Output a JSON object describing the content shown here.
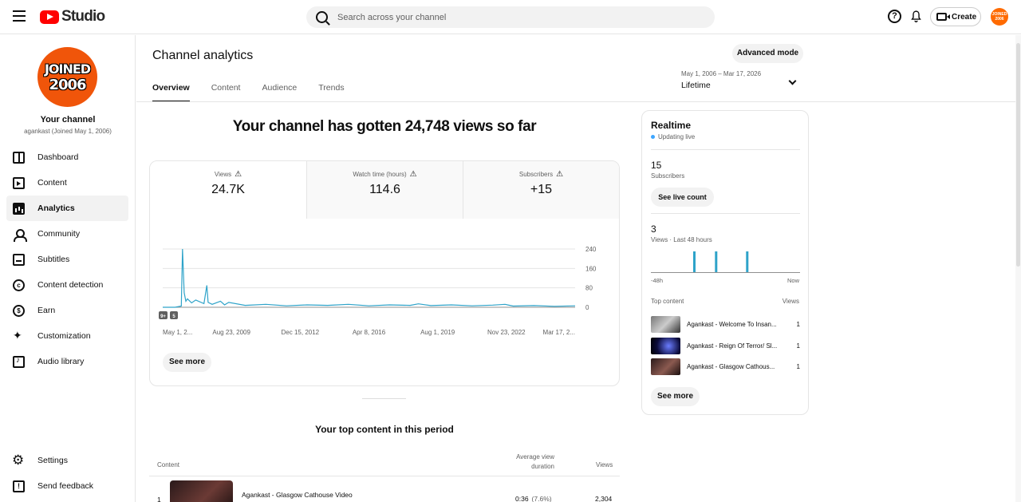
{
  "header": {
    "app_name": "Studio",
    "search_placeholder": "Search across your channel",
    "help_glyph": "?",
    "create_label": "Create",
    "avatar_text": "JOINED 2006"
  },
  "sidebar": {
    "avatar_line1": "JOINED",
    "avatar_line2": "2006",
    "channel_title": "Your channel",
    "channel_subtitle": "agankast (Joined May 1, 2006)",
    "items": [
      {
        "label": "Dashboard",
        "icon": "dashboard-icon"
      },
      {
        "label": "Content",
        "icon": "content-icon"
      },
      {
        "label": "Analytics",
        "icon": "analytics-icon",
        "active": true
      },
      {
        "label": "Community",
        "icon": "community-icon"
      },
      {
        "label": "Subtitles",
        "icon": "subtitles-icon"
      },
      {
        "label": "Content detection",
        "icon": "copyright-icon"
      },
      {
        "label": "Earn",
        "icon": "dollar-icon"
      },
      {
        "label": "Customization",
        "icon": "magic-wand-icon"
      },
      {
        "label": "Audio library",
        "icon": "audio-library-icon"
      }
    ],
    "bottom_items": [
      {
        "label": "Settings",
        "icon": "gear-icon"
      },
      {
        "label": "Send feedback",
        "icon": "feedback-icon"
      }
    ]
  },
  "main": {
    "title": "Channel analytics",
    "advanced_mode_label": "Advanced mode",
    "tabs": [
      "Overview",
      "Content",
      "Audience",
      "Trends"
    ],
    "active_tab": "Overview",
    "date_range": "May 1, 2006 – Mar 17, 2026",
    "date_period": "Lifetime",
    "headline": "Your channel has gotten 24,748 views so far",
    "metrics": [
      {
        "label": "Views",
        "value": "24.7K"
      },
      {
        "label": "Watch time (hours)",
        "value": "114.6"
      },
      {
        "label": "Subscribers",
        "value": "+15"
      }
    ],
    "warning_glyph": "⚠",
    "chart_badges": [
      "9+",
      "5"
    ],
    "see_more_label": "See more",
    "top_content_title": "Your top content in this period",
    "table": {
      "col_content": "Content",
      "col_avg_line1": "Average view",
      "col_avg_line2": "duration",
      "col_views": "Views",
      "rows": [
        {
          "rank": "1",
          "title": "Agankast - Glasgow Cathouse Video",
          "avg": "0:36",
          "pct": "(7.6%)",
          "views": "2,304"
        }
      ]
    }
  },
  "chart_data": {
    "type": "line",
    "x_tick_labels": [
      "May 1, 2...",
      "Aug 23, 2009",
      "Dec 15, 2012",
      "Apr 8, 2016",
      "Aug 1, 2019",
      "Nov 23, 2022",
      "Mar 17, 2..."
    ],
    "y_tick_labels": [
      "240",
      "160",
      "80",
      "0"
    ],
    "ylim": [
      0,
      240
    ],
    "gridlines": true,
    "series": [
      {
        "color": "#2ea3c9",
        "x_fraction": [
          0,
          0.03,
          0.045,
          0.048,
          0.052,
          0.056,
          0.06,
          0.07,
          0.08,
          0.1,
          0.107,
          0.11,
          0.12,
          0.14,
          0.15,
          0.16,
          0.2,
          0.25,
          0.3,
          0.35,
          0.4,
          0.45,
          0.5,
          0.55,
          0.6,
          0.62,
          0.65,
          0.7,
          0.75,
          0.8,
          0.83,
          0.85,
          0.9,
          0.95,
          1
        ],
        "values": [
          0,
          0,
          5,
          240,
          60,
          25,
          35,
          18,
          30,
          15,
          90,
          20,
          12,
          25,
          10,
          20,
          8,
          12,
          6,
          10,
          8,
          12,
          6,
          10,
          8,
          14,
          7,
          10,
          6,
          9,
          12,
          5,
          7,
          4,
          6
        ]
      }
    ]
  },
  "realtime": {
    "title": "Realtime",
    "status": "Updating live",
    "subscribers_value": "15",
    "subscribers_label": "Subscribers",
    "live_count_label": "See live count",
    "views_value": "3",
    "views_label": "Views · Last 48 hours",
    "bar_color": "#2ea3c9",
    "bars_hour_ago": [
      34,
      27,
      17
    ],
    "axis_left": "-48h",
    "axis_right": "Now",
    "top_content_label": "Top content",
    "views_col_label": "Views",
    "items": [
      {
        "title": "Agankast - Welcome To Insan...",
        "views": "1"
      },
      {
        "title": "Agankast - Reign Of Terror/ Sl...",
        "views": "1"
      },
      {
        "title": "Agankast - Glasgow Cathous...",
        "views": "1"
      }
    ],
    "see_more_label": "See more"
  }
}
